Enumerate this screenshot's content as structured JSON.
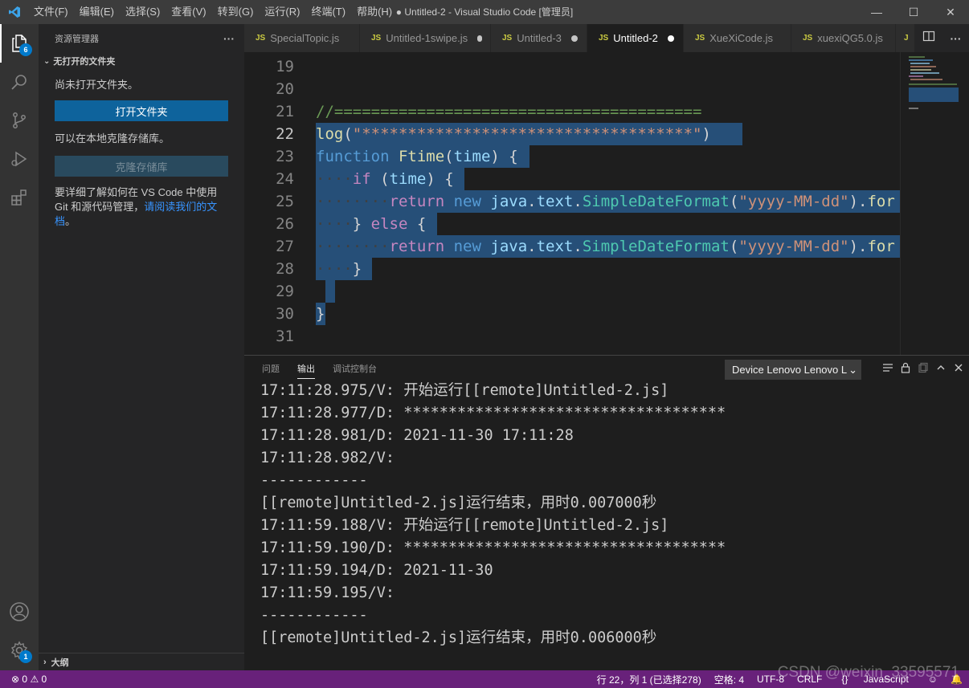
{
  "titlebar": {
    "menu": [
      "文件(F)",
      "编辑(E)",
      "选择(S)",
      "查看(V)",
      "转到(G)",
      "运行(R)",
      "终端(T)",
      "帮助(H)"
    ],
    "title": "● Untitled-2 - Visual Studio Code [管理员]"
  },
  "activitybar": {
    "explorer_badge": "6",
    "settings_badge": "1"
  },
  "sidebar": {
    "header": "资源管理器",
    "more": "···",
    "section": "无打开的文件夹",
    "no_folder_text": "尚未打开文件夹。",
    "open_folder_button": "打开文件夹",
    "clone_text": "可以在本地克隆存储库。",
    "clone_button": "克隆存储库",
    "git_text_1": "要详细了解如何在 VS Code 中使用",
    "git_text_2": "Git 和源代码管理，",
    "git_link_a": "请阅读我们的文",
    "git_link_b": "档",
    "git_text_3": "。",
    "outline": "大纲"
  },
  "tabs": [
    {
      "label": "SpecialTopic.js",
      "dirty": false,
      "active": false
    },
    {
      "label": "Untitled-1swipe.js",
      "dirty": true,
      "active": false
    },
    {
      "label": "Untitled-3",
      "dirty": true,
      "active": false
    },
    {
      "label": "Untitled-2",
      "dirty": true,
      "active": true
    },
    {
      "label": "XueXiCode.js",
      "dirty": true,
      "active": false
    },
    {
      "label": "xuexiQG5.0.js",
      "dirty": false,
      "active": false
    },
    {
      "label": "J",
      "dirty": false,
      "active": false
    }
  ],
  "editor": {
    "line_numbers": [
      "19",
      "20",
      "21",
      "22",
      "23",
      "24",
      "25",
      "26",
      "27",
      "28",
      "29",
      "30",
      "31"
    ],
    "current_line": "22"
  },
  "panel": {
    "tabs": [
      "问题",
      "输出",
      "调试控制台"
    ],
    "active_tab": "输出",
    "channel": "Device Lenovo Lenovo L",
    "output_lines": [
      "17:11:28.975/V: 开始运行[[remote]Untitled-2.js]",
      "17:11:28.977/D: ************************************",
      "17:11:28.981/D: 2021-11-30 17:11:28",
      "17:11:28.982/V: ",
      "------------",
      "[[remote]Untitled-2.js]运行结束，用时0.007000秒",
      "17:11:59.188/V: 开始运行[[remote]Untitled-2.js]",
      "17:11:59.190/D: ************************************",
      "17:11:59.194/D: 2021-11-30",
      "17:11:59.195/V: ",
      "------------",
      "[[remote]Untitled-2.js]运行结束，用时0.006000秒"
    ]
  },
  "statusbar": {
    "errors": "0",
    "warnings": "0",
    "position": "行 22，列 1 (已选择278)",
    "spaces": "空格: 4",
    "encoding": "UTF-8",
    "eol": "CRLF",
    "language": "JavaScript"
  },
  "watermark": "CSDN @weixin_33595571",
  "colors": {
    "statusbar": "#68217a",
    "accent": "#007acc",
    "selection": "#264f78"
  }
}
